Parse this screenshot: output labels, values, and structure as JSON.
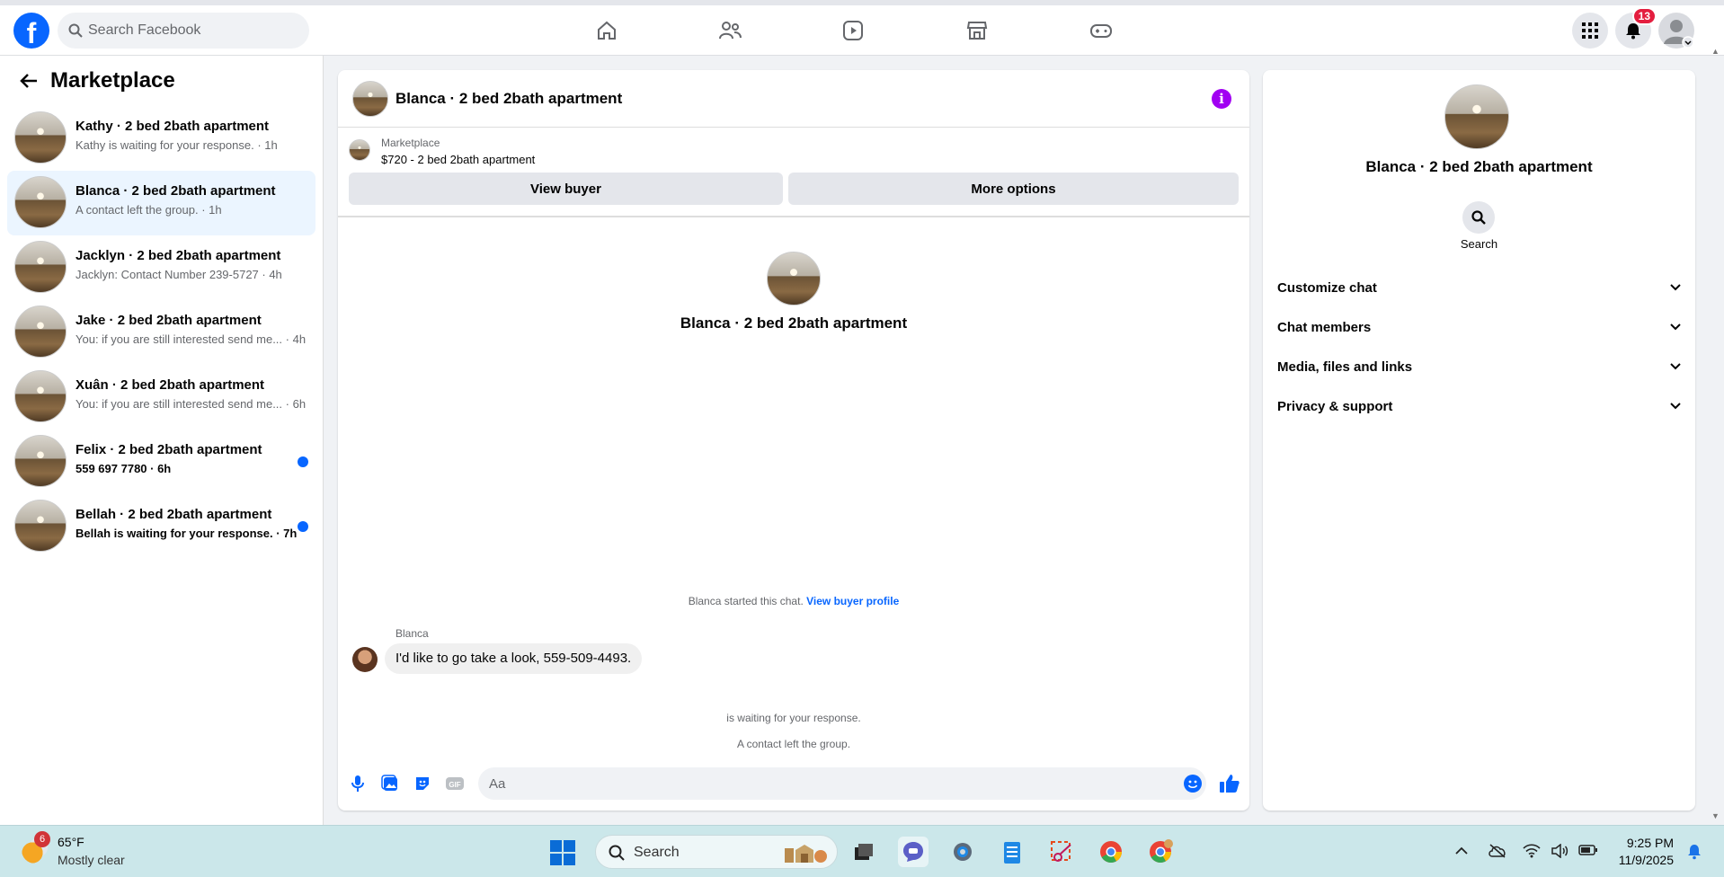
{
  "header": {
    "logo": "f",
    "search_placeholder": "Search Facebook",
    "notification_count": "13"
  },
  "sidebar": {
    "title": "Marketplace",
    "conversations": [
      {
        "title": "Kathy · 2 bed 2bath apartment",
        "subtitle": "Kathy is waiting for your response. · 1h",
        "unread": false,
        "active": false
      },
      {
        "title": "Blanca · 2 bed 2bath apartment",
        "subtitle": "A contact left the group. · 1h",
        "unread": false,
        "active": true
      },
      {
        "title": "Jacklyn · 2 bed 2bath apartment",
        "subtitle": "Jacklyn: Contact Number 239-5727 · 4h",
        "unread": false,
        "active": false
      },
      {
        "title": "Jake · 2 bed 2bath apartment",
        "subtitle": "You: if you are still interested send me... · 4h",
        "unread": false,
        "active": false
      },
      {
        "title": "Xuân · 2 bed 2bath apartment",
        "subtitle": "You: if you are still interested send me... · 6h",
        "unread": false,
        "active": false
      },
      {
        "title": "Felix · 2 bed 2bath apartment",
        "subtitle": "559 697 7780 · 6h",
        "unread": true,
        "active": false
      },
      {
        "title": "Bellah · 2 bed 2bath apartment",
        "subtitle": "Bellah is waiting for your response. · 7h",
        "unread": true,
        "active": false
      }
    ]
  },
  "chat": {
    "title": "Blanca · 2 bed 2bath apartment",
    "marketplace_label": "Marketplace",
    "listing": "$720 - 2 bed 2bath apartment",
    "view_buyer_label": "View buyer",
    "more_options_label": "More options",
    "center_name": "Blanca · 2 bed 2bath apartment",
    "started_text": "Blanca started this chat.",
    "view_buyer_profile": "View buyer profile",
    "sender": "Blanca",
    "message": "I'd like to go take a look, 559-509-4493.",
    "system_1": "is waiting for your response.",
    "system_2": "A contact left the group.",
    "composer_placeholder": "Aa",
    "accent": "#0866ff"
  },
  "info": {
    "name": "Blanca · 2 bed 2bath apartment",
    "search_label": "Search",
    "sections": [
      "Customize chat",
      "Chat members",
      "Media, files and links",
      "Privacy & support"
    ]
  },
  "taskbar": {
    "weather_badge": "6",
    "temperature": "65°F",
    "condition": "Mostly clear",
    "search_label": "Search",
    "time": "9:25 PM",
    "date": "11/9/2025"
  }
}
